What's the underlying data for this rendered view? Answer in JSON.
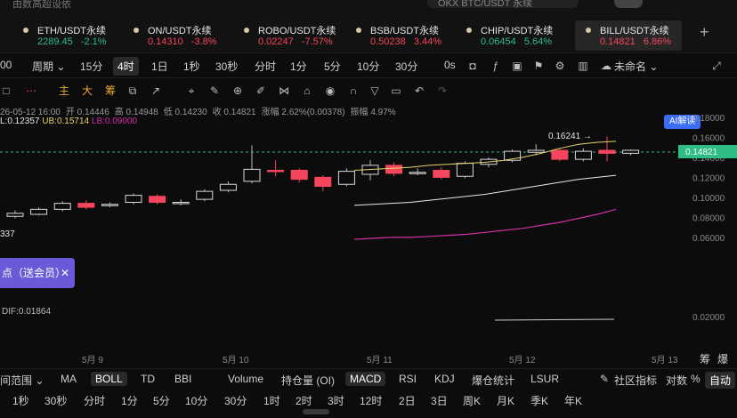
{
  "top_strip": {
    "left_text": "由数高超设依",
    "search_text": "OKX BTC/USDT 永续"
  },
  "tabs": [
    {
      "name": "ETH/USDT永续",
      "price": "2289.45",
      "change": "-2.1%",
      "dir": "up",
      "active": false
    },
    {
      "name": "ON/USDT永续",
      "price": "0.14310",
      "change": "-3.8%",
      "dir": "dn",
      "active": false
    },
    {
      "name": "ROBO/USDT永续",
      "price": "0.02247",
      "change": "-7.57%",
      "dir": "dn",
      "active": false
    },
    {
      "name": "BSB/USDT永续",
      "price": "0.50238",
      "change": "3.44%",
      "dir": "dn",
      "active": false
    },
    {
      "name": "CHIP/USDT永续",
      "price": "0.06454",
      "change": "5.64%",
      "dir": "up",
      "active": false
    },
    {
      "name": "BILL/USDT永续",
      "price": "0.14821",
      "change": "6.86%",
      "dir": "dn",
      "active": true
    }
  ],
  "add_tab": "+",
  "toolbar1": {
    "prefix": "00",
    "period_label": "周期 ⌄",
    "intervals": [
      "15分",
      "4时",
      "1日",
      "1秒",
      "30秒",
      "分时",
      "1分",
      "5分",
      "10分",
      "30分",
      "0s"
    ],
    "selected_interval": "4时",
    "layout_name": "未命名 ⌄",
    "ai_label": "AI解读"
  },
  "toolbar2": {
    "zhu": "主",
    "da": "大",
    "chou": "筹"
  },
  "info": {
    "line1": [
      "26-05-12 16:00",
      "开 0.14446",
      "高 0.14948",
      "低 0.14230",
      "收 0.14821",
      "涨幅 2.62%(0.00378)",
      "振幅 4.97%"
    ],
    "line2_ml": "L:0.12357",
    "line2_ub": "UB:0.15714",
    "line2_lb": "LB:0.09000"
  },
  "chart_data": {
    "type": "candlestick",
    "y_ticks": [
      "0.18000",
      "0.16000",
      "0.14000",
      "0.12000",
      "0.10000",
      "0.08000",
      "0.06000"
    ],
    "macd_tick": "0.02000",
    "x_labels": [
      "5月 9",
      "5月 10",
      "5月 11",
      "5月 12",
      "5月 13"
    ],
    "current_price": "0.14821",
    "high_marker": "0.16241 →",
    "left_low_label": "337",
    "macd_label": "DIF:0.01864",
    "candles": [
      {
        "o": 0.082,
        "c": 0.085,
        "h": 0.088,
        "l": 0.08
      },
      {
        "o": 0.084,
        "c": 0.089,
        "h": 0.091,
        "l": 0.083
      },
      {
        "o": 0.089,
        "c": 0.095,
        "h": 0.097,
        "l": 0.087
      },
      {
        "o": 0.095,
        "c": 0.091,
        "h": 0.098,
        "l": 0.089
      },
      {
        "o": 0.093,
        "c": 0.094,
        "h": 0.096,
        "l": 0.091
      },
      {
        "o": 0.096,
        "c": 0.103,
        "h": 0.105,
        "l": 0.094
      },
      {
        "o": 0.102,
        "c": 0.096,
        "h": 0.104,
        "l": 0.094
      },
      {
        "o": 0.095,
        "c": 0.096,
        "h": 0.099,
        "l": 0.093
      },
      {
        "o": 0.099,
        "c": 0.107,
        "h": 0.109,
        "l": 0.097
      },
      {
        "o": 0.108,
        "c": 0.114,
        "h": 0.117,
        "l": 0.106
      },
      {
        "o": 0.117,
        "c": 0.129,
        "h": 0.153,
        "l": 0.115
      },
      {
        "o": 0.128,
        "c": 0.127,
        "h": 0.138,
        "l": 0.122
      },
      {
        "o": 0.128,
        "c": 0.119,
        "h": 0.13,
        "l": 0.116
      },
      {
        "o": 0.121,
        "c": 0.112,
        "h": 0.123,
        "l": 0.107
      },
      {
        "o": 0.114,
        "c": 0.127,
        "h": 0.13,
        "l": 0.112
      },
      {
        "o": 0.124,
        "c": 0.133,
        "h": 0.138,
        "l": 0.118
      },
      {
        "o": 0.133,
        "c": 0.125,
        "h": 0.136,
        "l": 0.122
      },
      {
        "o": 0.126,
        "c": 0.126,
        "h": 0.13,
        "l": 0.123
      },
      {
        "o": 0.128,
        "c": 0.121,
        "h": 0.131,
        "l": 0.119
      },
      {
        "o": 0.122,
        "c": 0.135,
        "h": 0.137,
        "l": 0.12
      },
      {
        "o": 0.134,
        "c": 0.139,
        "h": 0.141,
        "l": 0.131
      },
      {
        "o": 0.138,
        "c": 0.147,
        "h": 0.149,
        "l": 0.136
      },
      {
        "o": 0.146,
        "c": 0.148,
        "h": 0.154,
        "l": 0.143
      },
      {
        "o": 0.148,
        "c": 0.139,
        "h": 0.15,
        "l": 0.137
      },
      {
        "o": 0.139,
        "c": 0.147,
        "h": 0.15,
        "l": 0.137
      },
      {
        "o": 0.148,
        "c": 0.145,
        "h": 0.162,
        "l": 0.137
      },
      {
        "o": 0.145,
        "c": 0.148,
        "h": 0.149,
        "l": 0.143
      }
    ],
    "boll_upper": [
      0.128,
      0.129,
      0.13,
      0.131,
      0.133,
      0.134,
      0.135,
      0.136,
      0.138,
      0.141,
      0.145,
      0.15,
      0.154,
      0.156,
      0.157
    ],
    "boll_mid": [
      0.093,
      0.094,
      0.095,
      0.096,
      0.098,
      0.1,
      0.102,
      0.104,
      0.107,
      0.11,
      0.113,
      0.116,
      0.119,
      0.121,
      0.123
    ],
    "boll_lower": [
      0.059,
      0.06,
      0.061,
      0.061,
      0.062,
      0.063,
      0.064,
      0.066,
      0.068,
      0.07,
      0.073,
      0.076,
      0.08,
      0.084,
      0.089
    ]
  },
  "promo": {
    "text": "点（送会员）",
    "close": "✕"
  },
  "bottom1": {
    "range": "间范围 ⌄",
    "indicators": [
      "MA",
      "BOLL",
      "TD",
      "BBI",
      "Volume",
      "持仓量 (OI)",
      "MACD",
      "RSI",
      "KDJ",
      "爆仓统计",
      "LSUR"
    ],
    "selected": [
      "BOLL",
      "MACD"
    ],
    "community": "社区指标",
    "log": "对数",
    "pct": "%",
    "auto": "自动"
  },
  "bottom2": {
    "intervals": [
      "1秒",
      "30秒",
      "分时",
      "1分",
      "5分",
      "10分",
      "30分",
      "1时",
      "2时",
      "3时",
      "12时",
      "2日",
      "3日",
      "周K",
      "月K",
      "季K",
      "年K"
    ]
  },
  "right_bits": {
    "zhu": "筹",
    "bao": "爆"
  }
}
